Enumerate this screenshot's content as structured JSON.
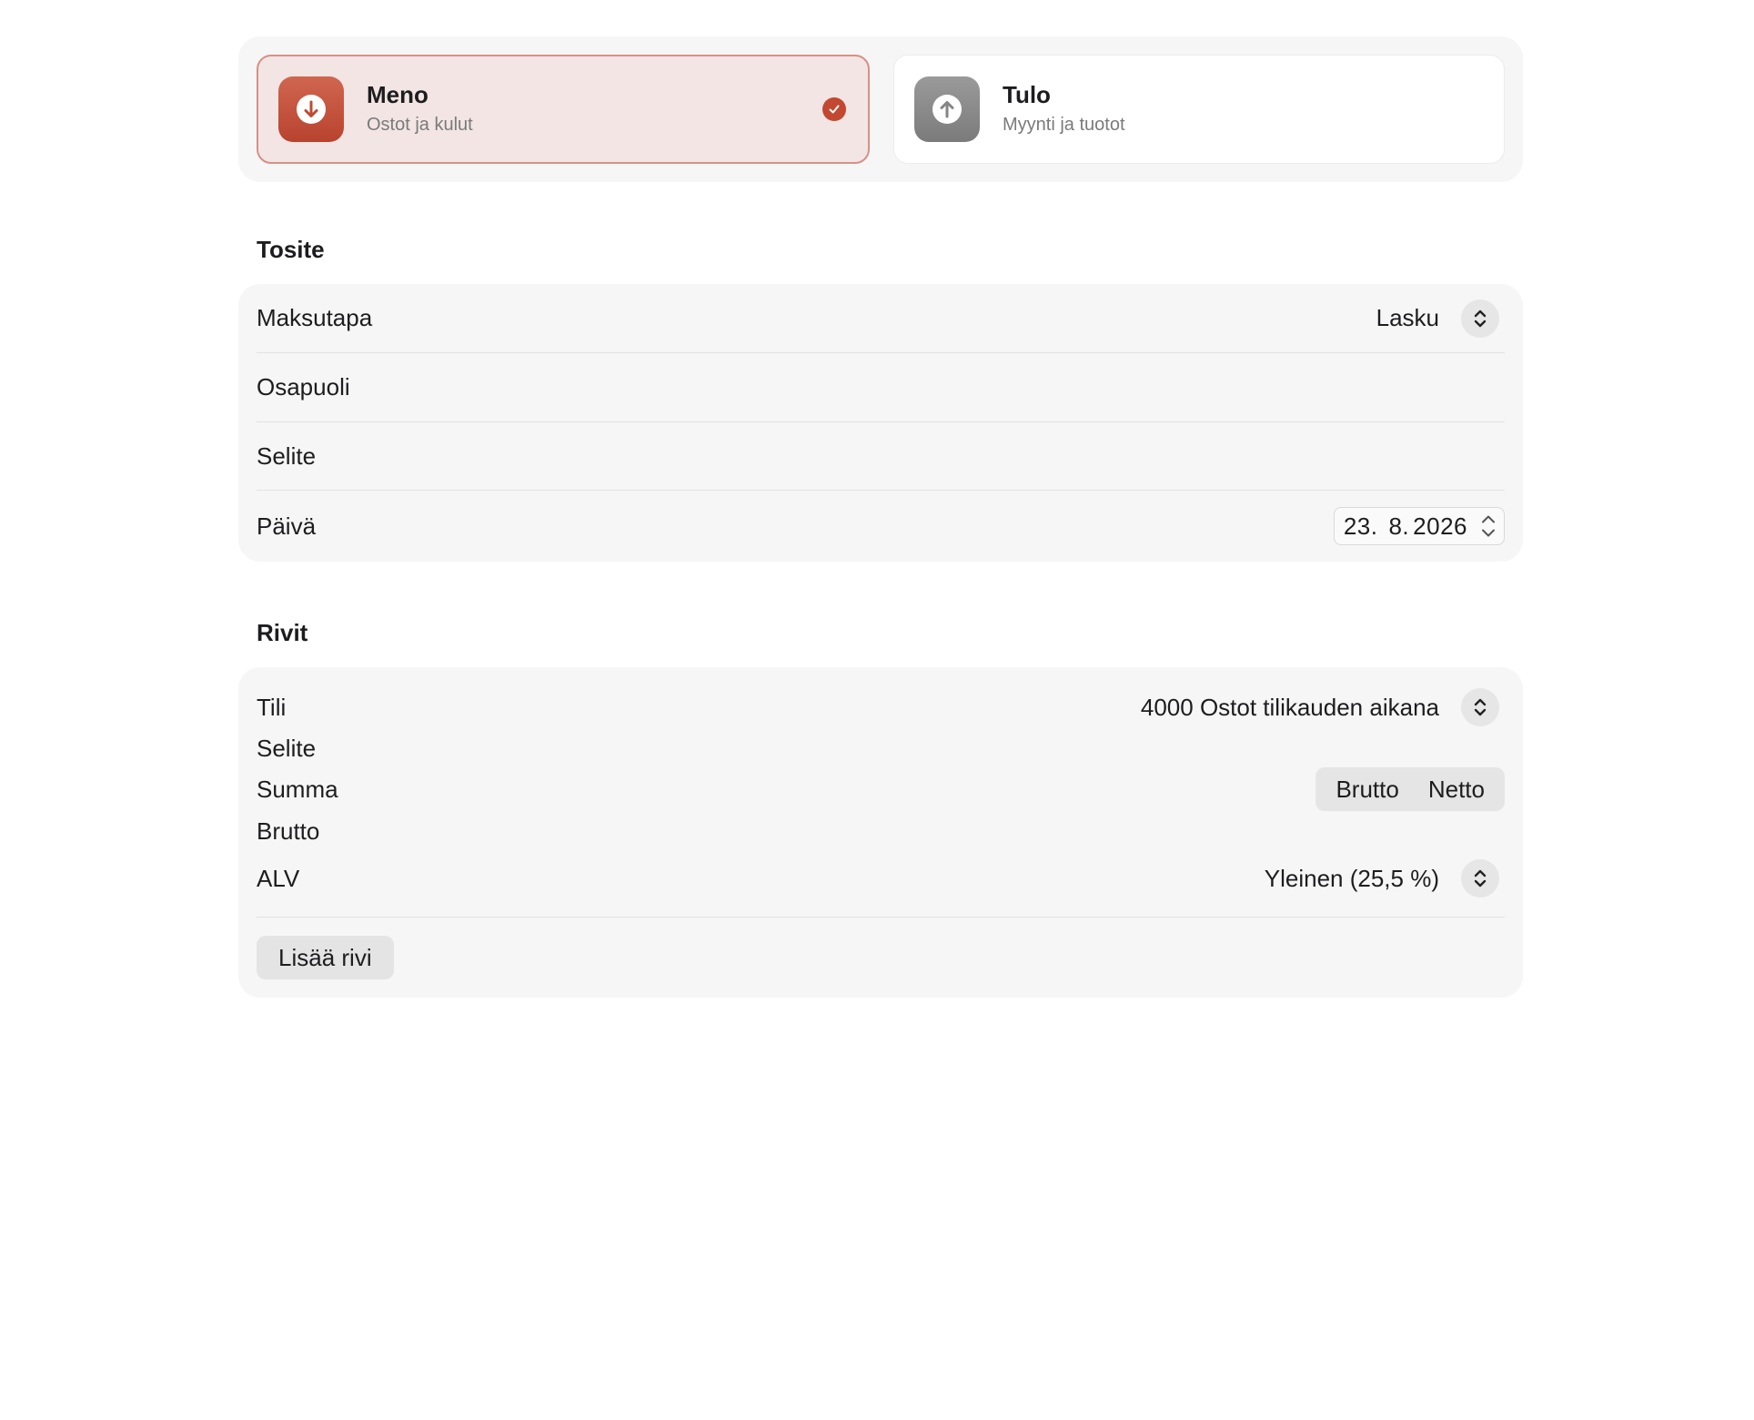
{
  "type_selector": {
    "expense": {
      "title": "Meno",
      "subtitle": "Ostot ja kulut",
      "selected": true
    },
    "income": {
      "title": "Tulo",
      "subtitle": "Myynti ja tuotot",
      "selected": false
    }
  },
  "tosite": {
    "section_title": "Tosite",
    "payment_method_label": "Maksutapa",
    "payment_method_value": "Lasku",
    "party_label": "Osapuoli",
    "description_label": "Selite",
    "date_label": "Päivä",
    "date_day": "23.",
    "date_month": "8.",
    "date_year": "2026"
  },
  "rivit": {
    "section_title": "Rivit",
    "account_label": "Tili",
    "account_value": "4000 Ostot tilikauden aikana",
    "description_label": "Selite",
    "amount_label": "Summa",
    "amount_modes": [
      "Brutto",
      "Netto"
    ],
    "gross_label": "Brutto",
    "vat_label": "ALV",
    "vat_value": "Yleinen (25,5 %)",
    "add_row_label": "Lisää rivi"
  },
  "colors": {
    "accent": "#c24832",
    "selected_bg": "#f2e5e4",
    "selected_border": "#d98f86",
    "group_bg": "#f6f6f6"
  },
  "icons": {
    "expense": "arrow-down-circle-icon",
    "income": "arrow-up-circle-icon",
    "selected": "checkmark-circle-icon",
    "popup": "chevron-up-down-icon",
    "stepper": "stepper-arrows-icon"
  }
}
